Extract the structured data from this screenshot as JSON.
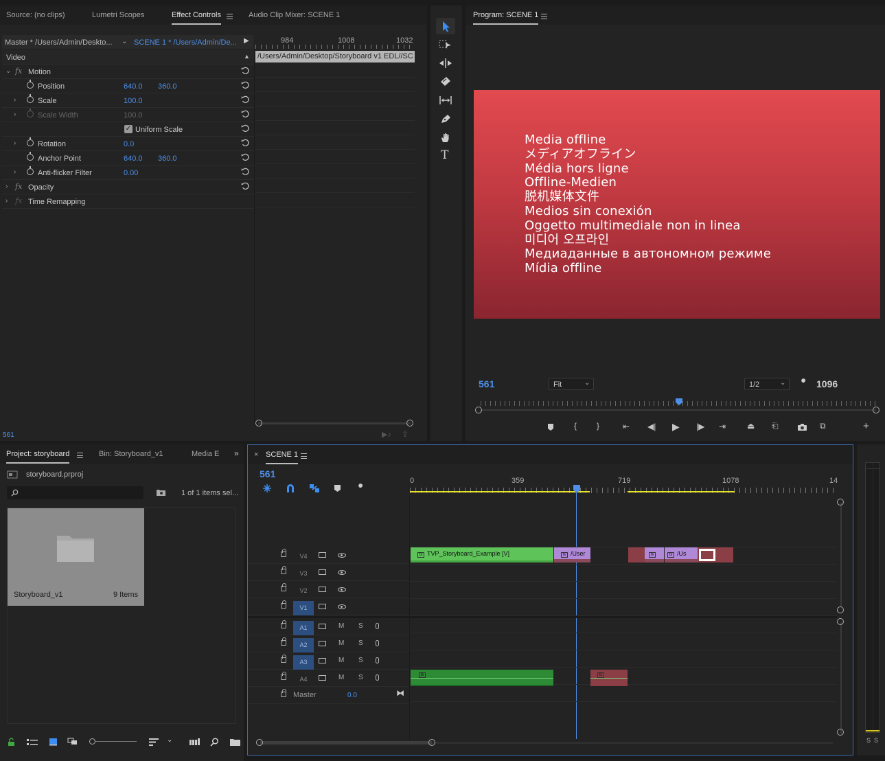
{
  "effect_controls": {
    "tabs": [
      "Source: (no clips)",
      "Lumetri Scopes",
      "Effect Controls",
      "Audio Clip Mixer: SCENE 1"
    ],
    "master_clip": "Master * /Users/Admin/Deskto...",
    "sequence_clip": "SCENE 1 * /Users/Admin/De...",
    "mini_ruler": [
      "984",
      "1008",
      "1032"
    ],
    "clip_path_bar": "/Users/Admin/Desktop/Storyboard v1 EDL//SC",
    "video_header": "Video",
    "motion": "Motion",
    "properties": [
      {
        "name": "Position",
        "v1": "640.0",
        "v2": "360.0"
      },
      {
        "name": "Scale",
        "v1": "100.0",
        "v2": ""
      },
      {
        "name": "Scale Width",
        "v1": "100.0",
        "v2": ""
      },
      {
        "name": "Uniform Scale",
        "v1": "",
        "v2": ""
      },
      {
        "name": "Rotation",
        "v1": "0.0",
        "v2": ""
      },
      {
        "name": "Anchor Point",
        "v1": "640.0",
        "v2": "360.0"
      },
      {
        "name": "Anti-flicker Filter",
        "v1": "0.00",
        "v2": ""
      }
    ],
    "opacity": "Opacity",
    "time_remapping": "Time Remapping",
    "timecode": "561"
  },
  "program": {
    "title": "Program: SCENE 1",
    "offline_lines": [
      "Media offline",
      "メディアオフライン",
      "Média hors ligne",
      "Offline-Medien",
      "脱机媒体文件",
      "Medios sin conexión",
      "Oggetto multimediale non in linea",
      "미디어 오프라인",
      "Медиаданные в автономном режиме",
      "Mídia offline"
    ],
    "timecode": "561",
    "fit": "Fit",
    "resolution": "1/2",
    "duration": "1096",
    "colors": {
      "offline_top": "#e24a4f",
      "offline_bottom": "#8a2530"
    }
  },
  "project": {
    "tabs": [
      "Project: storyboard",
      "Bin: Storyboard_v1",
      "Media E"
    ],
    "file": "storyboard.prproj",
    "items_count": "1 of 1 items sel...",
    "bin_name": "Storyboard_v1",
    "bin_items": "9 Items"
  },
  "timeline": {
    "title": "SCENE 1",
    "timecode": "561",
    "ruler": [
      "0",
      "359",
      "719",
      "1078",
      "14"
    ],
    "video_tracks": [
      "V4",
      "V3",
      "V2",
      "V1"
    ],
    "audio_tracks": [
      "A1",
      "A2",
      "A3",
      "A4"
    ],
    "m": "M",
    "s": "S",
    "master_label": "Master",
    "master_value": "0.0",
    "clips": {
      "v4_main": "TVP_Storyboard_Example [V]",
      "v4_second": "/User",
      "v4_third": "/Us"
    },
    "fx_label": "fx"
  },
  "meter": {
    "labels": [
      "S",
      "S"
    ]
  },
  "tool_icons": [
    "selection-tool-icon",
    "track-select-icon",
    "ripple-edit-icon",
    "razor-icon",
    "slip-icon",
    "pen-icon",
    "hand-icon",
    "type-icon"
  ]
}
